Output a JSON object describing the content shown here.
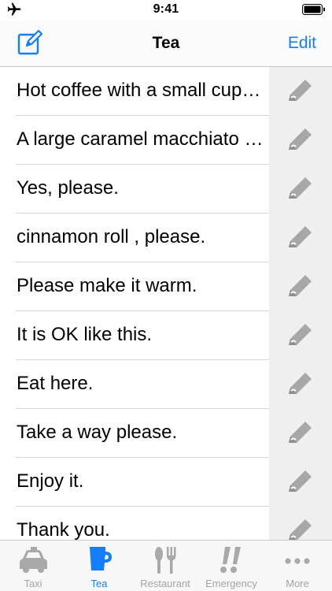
{
  "status_bar": {
    "time": "9:41",
    "airplane_icon": "airplane-icon",
    "battery_icon": "battery-icon"
  },
  "nav": {
    "title": "Tea",
    "edit_label": "Edit",
    "compose_icon": "compose-icon",
    "accent": "#157efb"
  },
  "phrases": [
    "Hot coffee with a small cup , please.",
    "A large caramel macchiato , please.",
    "Yes, please.",
    "cinnamon roll , please.",
    "Please make it warm.",
    "It is OK like this.",
    "Eat here.",
    "Take a way please.",
    "Enjoy it.",
    "Thank you."
  ],
  "row_action_icon": "pencil-icon",
  "tabs": [
    {
      "label": "Taxi",
      "icon": "taxi-icon",
      "active": false
    },
    {
      "label": "Tea",
      "icon": "cup-icon",
      "active": true
    },
    {
      "label": "Restaurant",
      "icon": "fork-knife-icon",
      "active": false
    },
    {
      "label": "Emergency",
      "icon": "exclamation-icon",
      "active": false
    },
    {
      "label": "More",
      "icon": "more-dots-icon",
      "active": false
    }
  ]
}
